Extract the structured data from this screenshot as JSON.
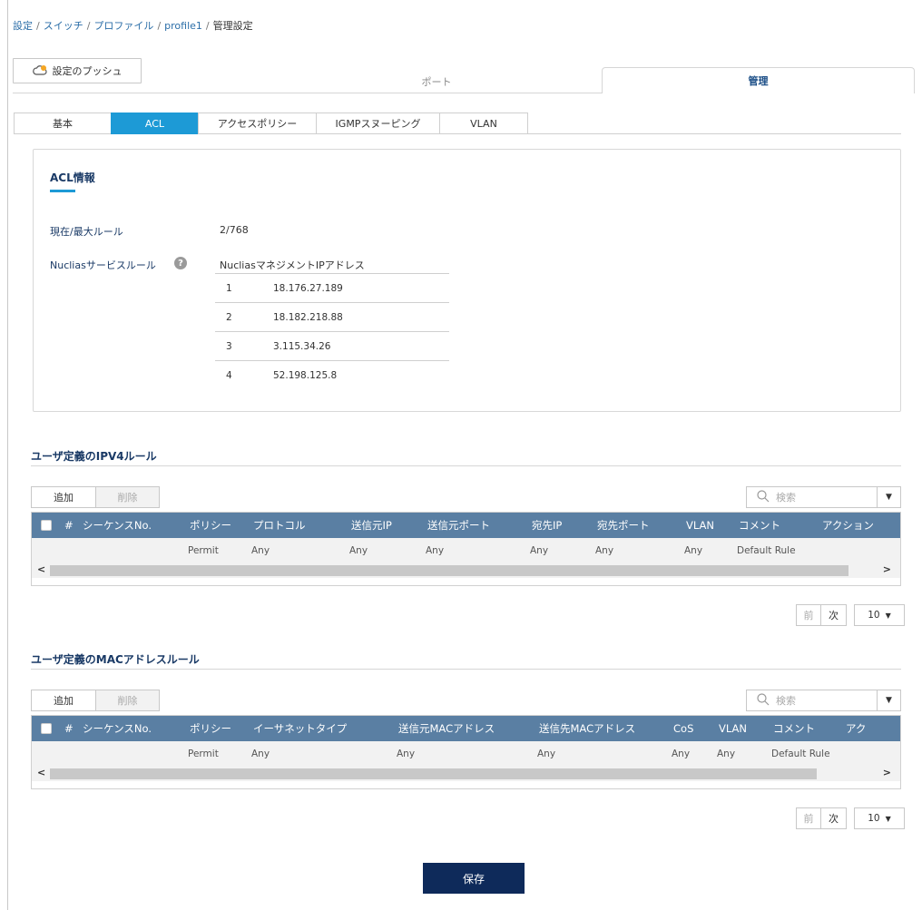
{
  "breadcrumb": [
    "設定",
    "スイッチ",
    "プロファイル",
    "profile1",
    "管理設定"
  ],
  "push_button": "設定のプッシュ",
  "main_tabs": {
    "port": "ポート",
    "admin": "管理"
  },
  "sub_tabs": [
    "基本",
    "ACL",
    "アクセスポリシー",
    "IGMPスヌーピング",
    "VLAN"
  ],
  "acl_info": {
    "title": "ACL情報",
    "current_max_label": "現在/最大ルール",
    "current_max_value": "2/768",
    "service_rule_label": "Nucliasサービスルール",
    "help_icon": "?",
    "ip_header": "NucliasマネジメントIPアドレス",
    "ips": [
      {
        "idx": "1",
        "ip": "18.176.27.189"
      },
      {
        "idx": "2",
        "ip": "18.182.218.88"
      },
      {
        "idx": "3",
        "ip": "3.115.34.26"
      },
      {
        "idx": "4",
        "ip": "52.198.125.8"
      }
    ]
  },
  "ipv4": {
    "title": "ユーザ定義のIPV4ルール",
    "add": "追加",
    "delete": "削除",
    "search_placeholder": "検索",
    "columns": [
      "#",
      "シーケンスNo.",
      "ポリシー",
      "プロトコル",
      "送信元IP",
      "送信元ポート",
      "宛先IP",
      "宛先ポート",
      "VLAN",
      "コメント",
      "アクション"
    ],
    "rows": [
      [
        "",
        "",
        "Permit",
        "Any",
        "Any",
        "Any",
        "Any",
        "Any",
        "Any",
        "Default Rule",
        ""
      ]
    ],
    "prev": "前",
    "next": "次",
    "page_size": "10"
  },
  "mac": {
    "title": "ユーザ定義のMACアドレスルール",
    "add": "追加",
    "delete": "削除",
    "search_placeholder": "検索",
    "columns": [
      "#",
      "シーケンスNo.",
      "ポリシー",
      "イーサネットタイプ",
      "送信元MACアドレス",
      "送信先MACアドレス",
      "CoS",
      "VLAN",
      "コメント",
      "アク"
    ],
    "rows": [
      [
        "",
        "",
        "Permit",
        "Any",
        "Any",
        "Any",
        "Any",
        "Any",
        "Default Rule",
        ""
      ]
    ],
    "prev": "前",
    "next": "次",
    "page_size": "10"
  },
  "save": "保存",
  "colors": {
    "accent": "#1d9ad6",
    "table_header": "#5a7fa3",
    "save_button": "#0e2a5a",
    "heading": "#1a3a66"
  }
}
